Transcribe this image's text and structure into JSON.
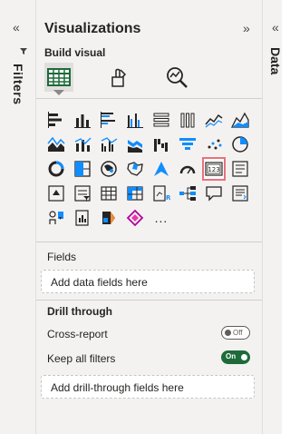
{
  "filters_pane": {
    "label": "Filters",
    "collapse_glyph": "«",
    "icon": "filter-icon"
  },
  "data_pane": {
    "label": "Data",
    "collapse_glyph": "«"
  },
  "viz_pane": {
    "title": "Visualizations",
    "collapse_glyph": "»",
    "build_label": "Build visual",
    "modes": [
      {
        "name": "build-visual",
        "icon": "table-grid-icon",
        "active": true
      },
      {
        "name": "format-visual",
        "icon": "paintbrush-icon",
        "active": false
      },
      {
        "name": "analytics",
        "icon": "magnifier-chart-icon",
        "active": false
      }
    ],
    "visual_types": [
      "stacked-bar-chart",
      "stacked-column-chart",
      "clustered-bar-chart",
      "clustered-column-chart",
      "100-stacked-bar-chart",
      "100-stacked-column-chart",
      "line-chart",
      "area-chart",
      "stacked-area-chart",
      "line-and-stacked-column-chart",
      "line-and-clustered-column-chart",
      "ribbon-chart",
      "waterfall-chart",
      "funnel-chart",
      "scatter-chart",
      "pie-chart",
      "donut-chart",
      "treemap",
      "map",
      "filled-map",
      "azure-map",
      "gauge",
      "card",
      "multi-row-card",
      "kpi",
      "slicer",
      "table",
      "matrix",
      "r-script-visual",
      "decomposition-tree",
      "qa-visual",
      "smart-narrative",
      "key-influencers",
      "paginated-report",
      "power-apps",
      "power-automate",
      "more-visuals"
    ],
    "selected_visual": "card",
    "more_label": "...",
    "fields_label": "Fields",
    "fields_placeholder": "Add data fields here",
    "drill_label": "Drill through",
    "cross_report_label": "Cross-report",
    "cross_report_toggle": "Off",
    "keep_filters_label": "Keep all filters",
    "keep_filters_toggle": "On",
    "drill_placeholder": "Add drill-through fields here"
  },
  "colors": {
    "accent_dark": "#252423",
    "accent_blue": "#118dff",
    "selection_highlight": "#e8727a",
    "toggle_on": "#1e6b3a"
  }
}
